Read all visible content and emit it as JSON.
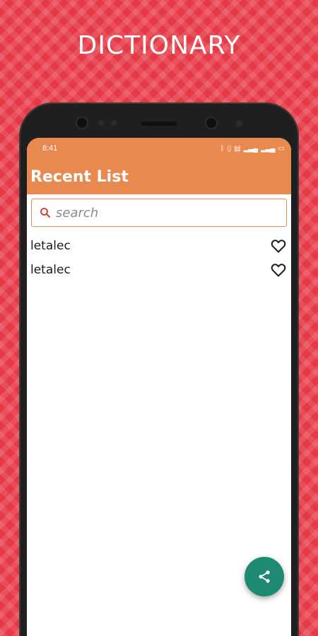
{
  "promo": {
    "title": "DICTIONARY"
  },
  "status_bar": {
    "time": "8:41",
    "icons": [
      "bluetooth-icon",
      "vibrate-icon",
      "volte-icon",
      "signal-icon",
      "signal-icon",
      "battery-icon"
    ]
  },
  "app_bar": {
    "title": "Recent List",
    "background": "#e8894f"
  },
  "search": {
    "placeholder": "search",
    "value": ""
  },
  "recent_list": {
    "items": [
      {
        "label": "letalec",
        "favorite": false
      },
      {
        "label": "letalec",
        "favorite": false
      }
    ]
  },
  "fab": {
    "icon": "share-icon",
    "color": "#1f8a72"
  },
  "colors": {
    "background": "#e63946",
    "accent": "#e8894f"
  }
}
